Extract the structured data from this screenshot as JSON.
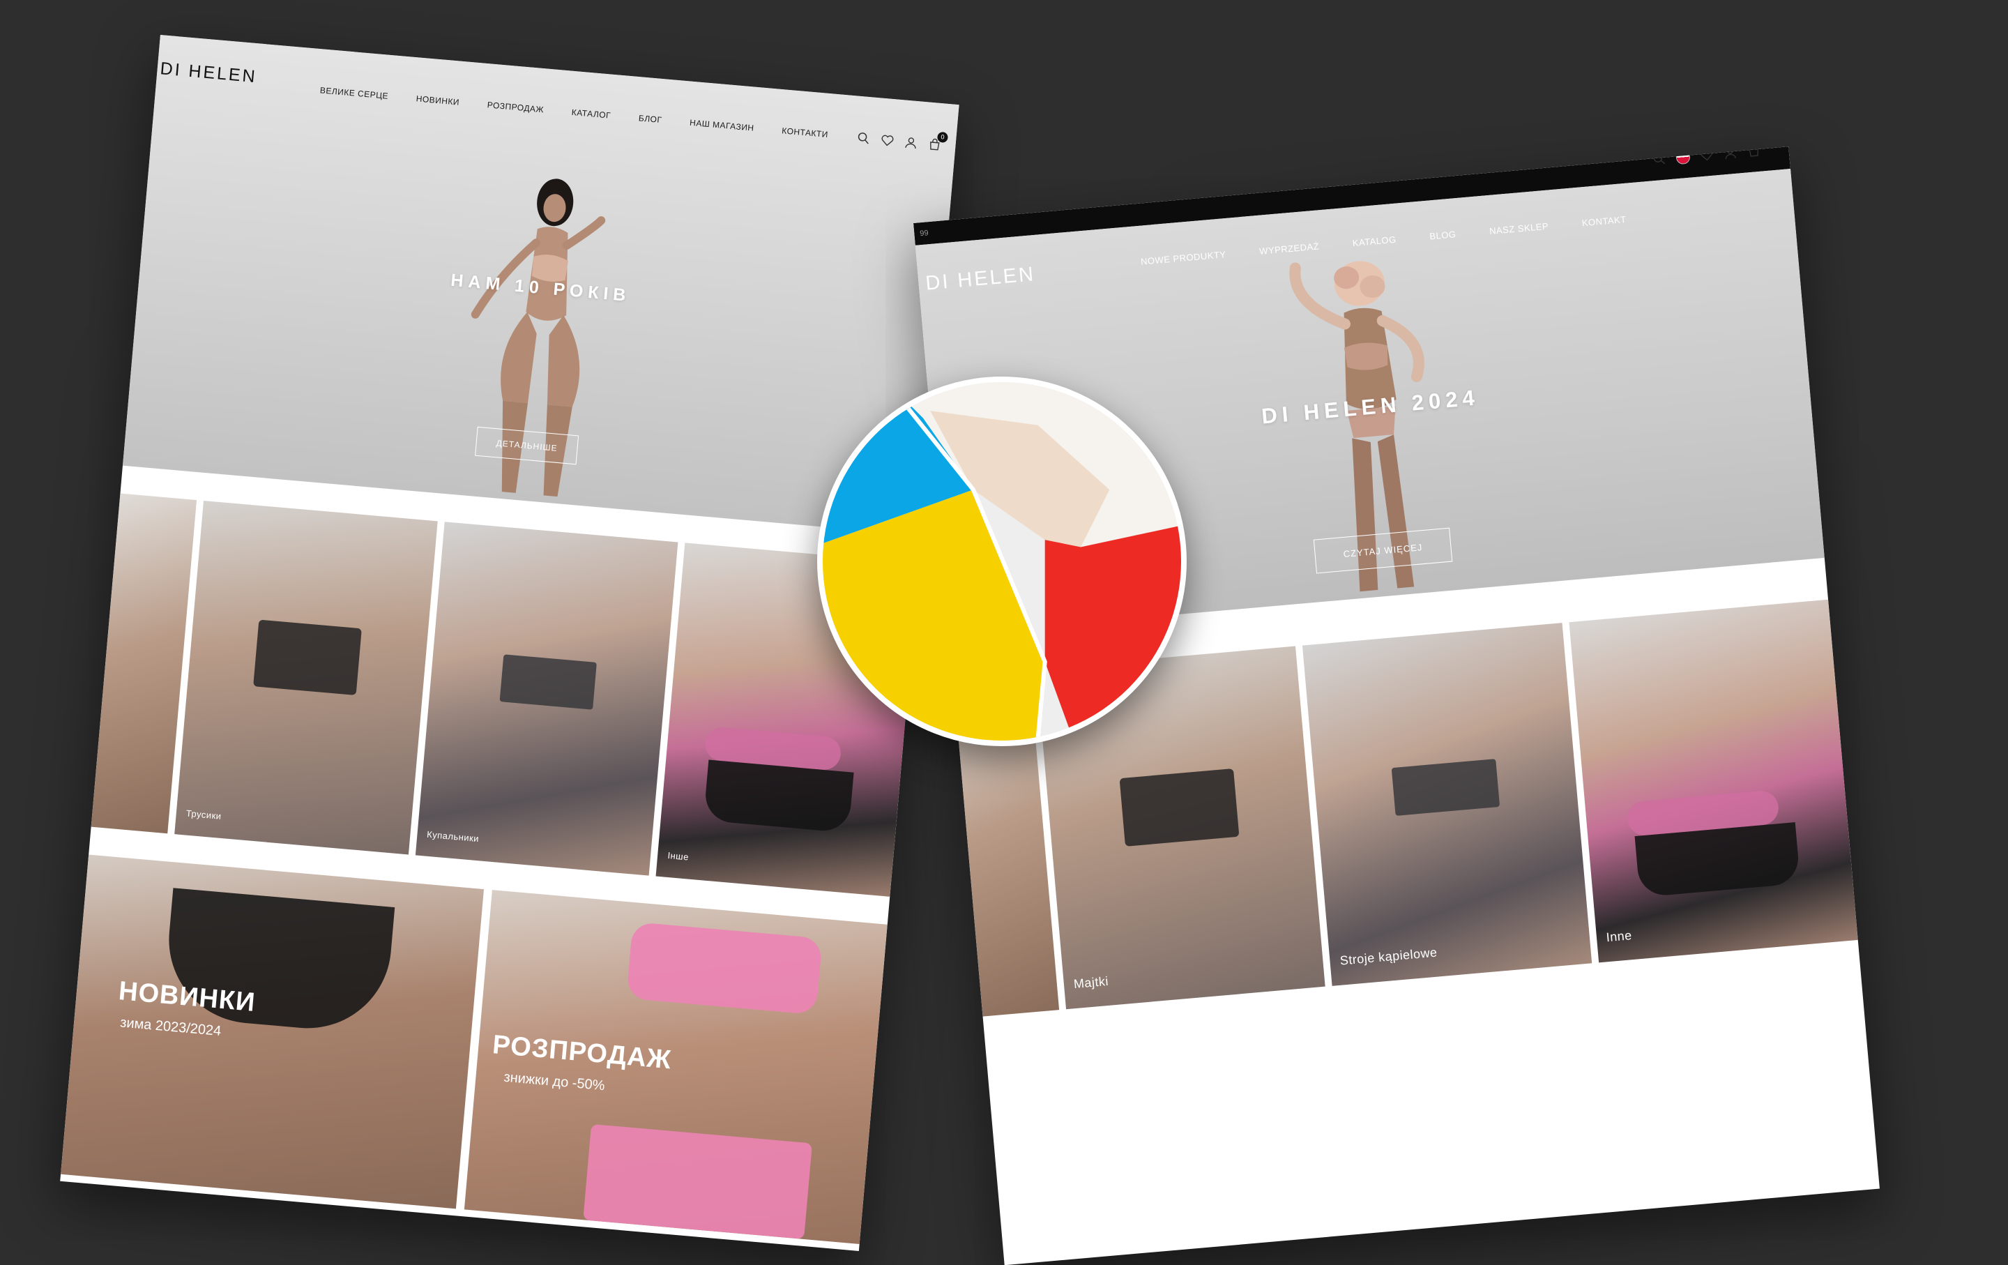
{
  "colors": {
    "background": "#2e2e2f",
    "ua_blue": "#0aa6e6",
    "ua_yellow": "#f7d000",
    "pl_white": "#f6f2ee",
    "pl_red": "#ee2a24"
  },
  "ua": {
    "brand": "DI HELEN",
    "menu": [
      "ВЕЛИКЕ СЕРЦЕ",
      "НОВИНКИ",
      "РОЗПРОДАЖ",
      "КАТАЛОГ",
      "БЛОГ",
      "НАШ МАГАЗИН",
      "КОНТАКТИ"
    ],
    "icons": [
      "search-icon",
      "heart-icon",
      "user-icon",
      "cart-icon"
    ],
    "cart_count": "0",
    "hero_title": "НАМ 10 РОКІВ",
    "hero_cta": "ДЕТАЛЬНІШЕ",
    "categories": [
      "",
      "Трусики",
      "Купальники",
      "Інше"
    ],
    "promos": [
      {
        "title": "НОВИНКИ",
        "subtitle": "зима 2023/2024"
      },
      {
        "title": "РОЗПРОДАЖ",
        "subtitle": "знижки до -50%"
      }
    ]
  },
  "pl": {
    "topbar_text": "99",
    "brand": "DI HELEN",
    "menu": [
      "NOWE PRODUKTY",
      "WYPRZEDAŻ",
      "KATALOG",
      "BLOG",
      "NASZ SKLEP",
      "KONTAKT"
    ],
    "icons": [
      "search-icon",
      "poland-flag-icon",
      "heart-icon",
      "user-icon",
      "cart-icon"
    ],
    "cart_count": "0",
    "hero_title": "DI HELEN 2024",
    "hero_cta": "CZYTAJ WIĘCEJ",
    "categories": [
      "",
      "Majtki",
      "Stroje kąpielowe",
      "Inne"
    ]
  }
}
